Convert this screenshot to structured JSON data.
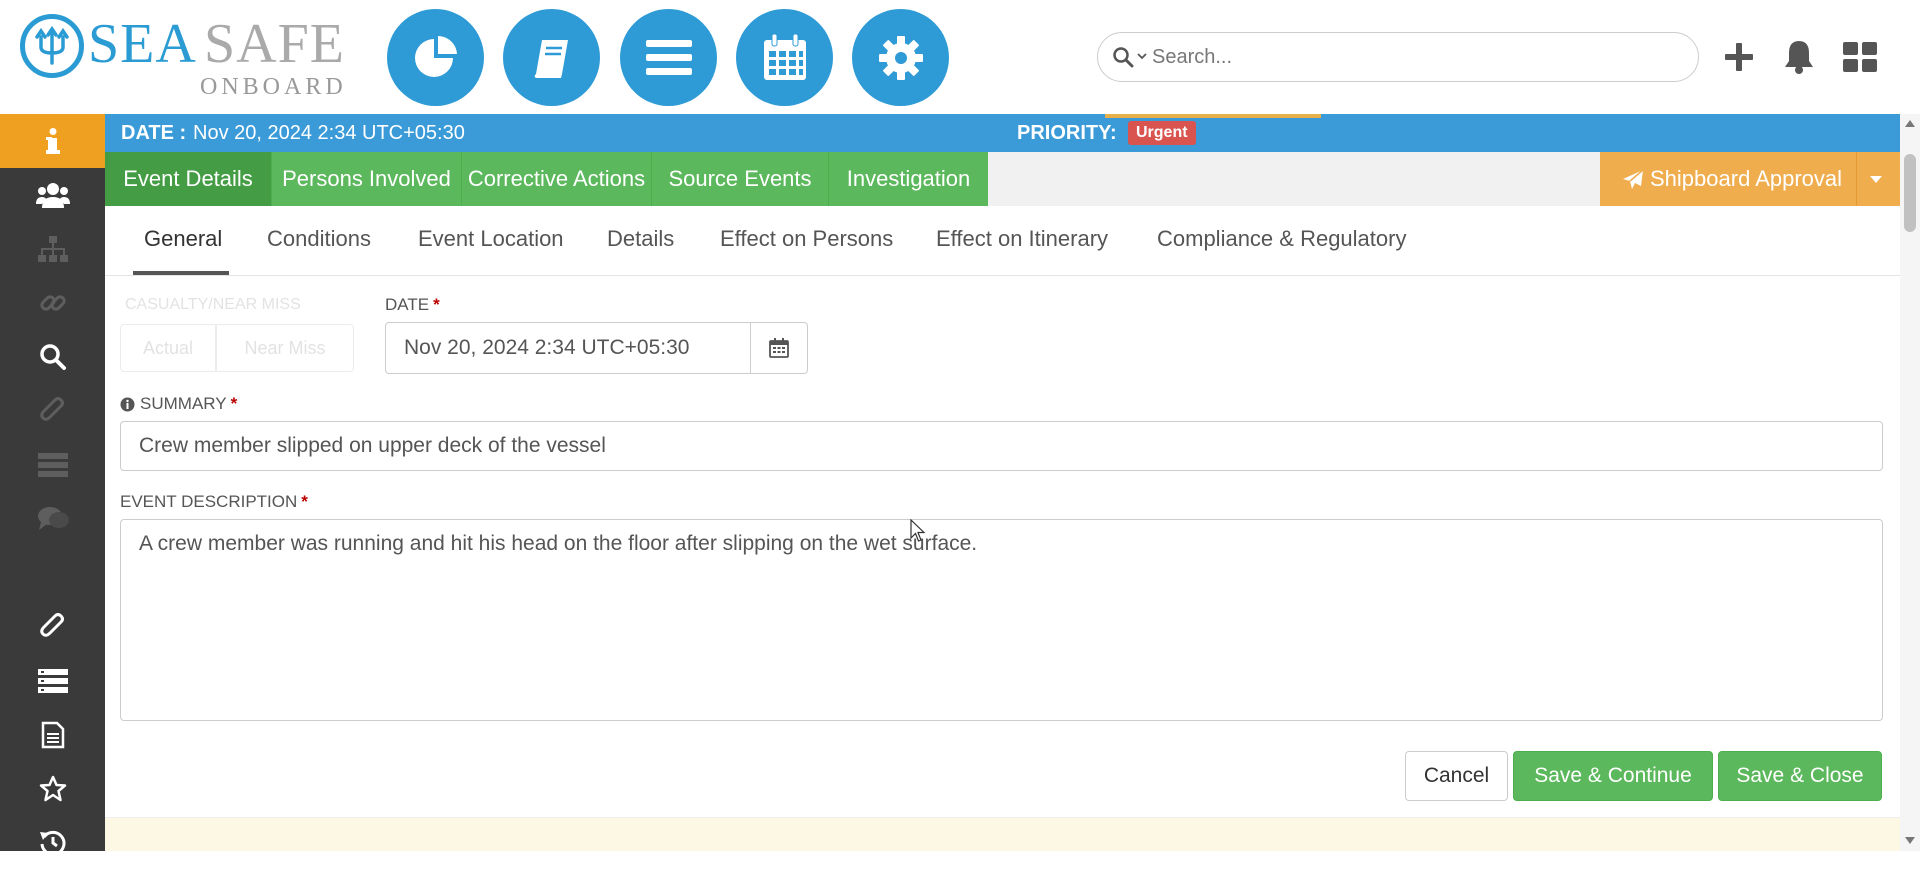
{
  "logo": {
    "sea": "SEA",
    "safe": "SAFE",
    "onboard": "ONBOARD"
  },
  "nav_icons": [
    "pie-chart-icon",
    "book-icon",
    "menu-icon",
    "calendar-icon",
    "gear-icon"
  ],
  "search": {
    "placeholder": "Search..."
  },
  "header_icons": [
    "plus-icon",
    "bell-icon",
    "grid-icon"
  ],
  "sidebar": [
    "info-icon",
    "users-icon",
    "sitemap-icon",
    "link-icon",
    "search-icon",
    "paperclip-icon",
    "list-icon",
    "comments-icon",
    "paperclip-icon",
    "list-icon",
    "document-icon",
    "star-icon",
    "history-icon"
  ],
  "banner": {
    "date_label": "DATE :",
    "date_value": "Nov 20, 2024 2:34 UTC+05:30",
    "priority_label": "PRIORITY:",
    "priority_value": "Urgent"
  },
  "tabs": [
    "Event Details",
    "Persons Involved",
    "Corrective Actions",
    "Source Events",
    "Investigation"
  ],
  "approval": {
    "label": "Shipboard Approval"
  },
  "subtabs": [
    "General",
    "Conditions",
    "Event Location",
    "Details",
    "Effect on Persons",
    "Effect on Itinerary",
    "Compliance & Regulatory"
  ],
  "form": {
    "ghost_type_label": "CASUALTY/NEAR MISS",
    "ghost_actual": "Actual",
    "ghost_near_miss": "Near Miss",
    "date_label": "DATE",
    "date_value": "Nov 20, 2024 2:34 UTC+05:30",
    "summary_label": "SUMMARY",
    "summary_value": "Crew member slipped on upper deck of the vessel",
    "desc_label": "EVENT DESCRIPTION",
    "desc_value": "A crew member was running and hit his head on the floor after slipping on the wet surface.",
    "required_mark": "*"
  },
  "buttons": {
    "cancel": "Cancel",
    "save_continue": "Save & Continue",
    "save_close": "Save & Close"
  },
  "colors": {
    "header_blue": "#2e9bd6",
    "banner_blue": "#3a9bd8",
    "tab_green": "#5cb85c",
    "accent_orange": "#f0ad4e",
    "urgent_red": "#d9534f"
  }
}
